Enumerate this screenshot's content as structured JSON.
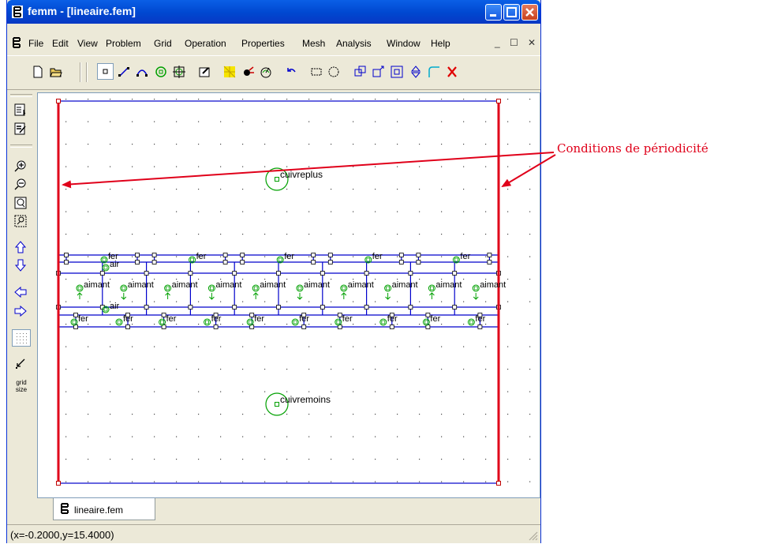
{
  "window": {
    "title": "femm - [lineaire.fem]"
  },
  "menu": [
    "File",
    "Edit",
    "View",
    "Problem",
    "Grid",
    "Operation",
    "Properties",
    "Mesh",
    "Analysis",
    "Window",
    "Help"
  ],
  "mdi_controls": [
    "_",
    "☐",
    "✕"
  ],
  "toolbar_icons": [
    "new-file-icon",
    "open-file-icon",
    "node-mode-icon",
    "segment-mode-icon",
    "arc-mode-icon",
    "block-label-mode-icon",
    "group-mode-icon",
    "edit-properties-icon",
    "mesh-icon",
    "run-analysis-icon",
    "view-results-icon",
    "undo-icon",
    "box-select-icon",
    "circle-select-icon",
    "copy-icon",
    "move-icon",
    "scale-icon",
    "mirror-icon",
    "fillet-icon",
    "delete-icon"
  ],
  "left_toolbar_icons": [
    "show-results-icon",
    "edit-notes-icon",
    "zoom-in-icon",
    "zoom-out-icon",
    "zoom-natural-icon",
    "zoom-window-icon",
    "pan-up-icon",
    "pan-down-icon",
    "pan-left-icon",
    "pan-right-icon",
    "show-grid-icon",
    "snap-grid-icon",
    "grid-size-icon"
  ],
  "grid_size_label": [
    "grid",
    "size"
  ],
  "canvas": {
    "labels": {
      "cuivreplus": "cuivreplus",
      "cuivremoins": "cuivremoins",
      "fer": "fer",
      "air": "air",
      "aimant": "aimant"
    }
  },
  "document_tab": "lineaire.fem",
  "status": {
    "coordinates": "(x=-0.2000,y=15.4000)"
  },
  "annotation": {
    "text": "Conditions de périodicité",
    "color": "#E0001A"
  },
  "colors": {
    "boundary": "#0000CC",
    "periodic": "#E0001A",
    "labels": "#008000",
    "titlebar": "#0054E3"
  }
}
